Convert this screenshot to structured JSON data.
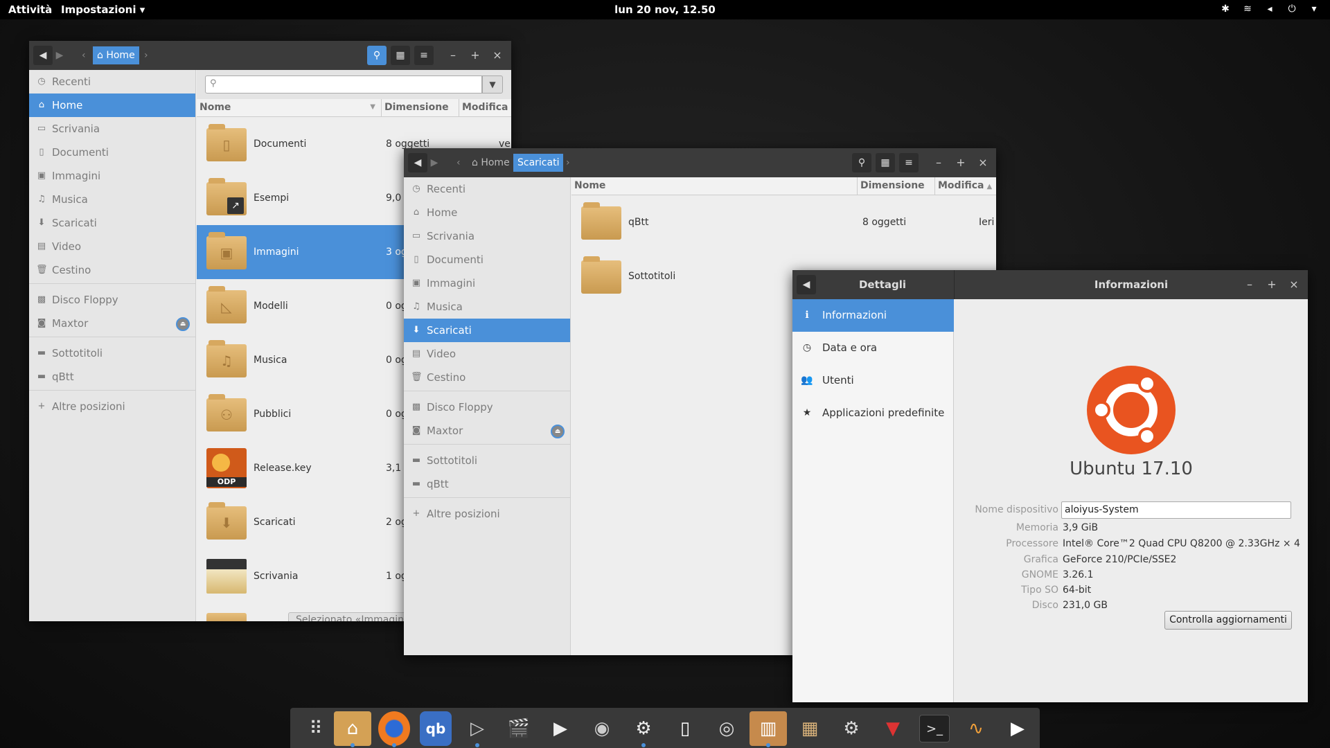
{
  "top_panel": {
    "activities": "Attività",
    "app_menu": "Impostazioni ▾",
    "clock": "lun 20 nov, 12.50"
  },
  "files_home": {
    "path_home": "Home",
    "sidebar": [
      {
        "label": "Recenti",
        "icon": "clock-icon"
      },
      {
        "label": "Home",
        "icon": "home-icon"
      },
      {
        "label": "Scrivania",
        "icon": "desktop-icon"
      },
      {
        "label": "Documenti",
        "icon": "document-icon"
      },
      {
        "label": "Immagini",
        "icon": "image-icon"
      },
      {
        "label": "Musica",
        "icon": "music-icon"
      },
      {
        "label": "Scaricati",
        "icon": "download-icon"
      },
      {
        "label": "Video",
        "icon": "video-icon"
      },
      {
        "label": "Cestino",
        "icon": "trash-icon"
      },
      {
        "label": "Disco Floppy",
        "icon": "floppy-icon"
      },
      {
        "label": "Maxtor",
        "icon": "drive-icon"
      },
      {
        "label": "Sottotitoli",
        "icon": "folder-icon"
      },
      {
        "label": "qBtt",
        "icon": "folder-icon"
      },
      {
        "label": "Altre posizioni",
        "icon": "plus-icon"
      }
    ],
    "columns": {
      "name": "Nome",
      "size": "Dimensione",
      "modified": "Modifica"
    },
    "rows": [
      {
        "name": "Documenti",
        "size": "8 oggetti",
        "modified": "ver"
      },
      {
        "name": "Esempi",
        "size": "9,0"
      },
      {
        "name": "Immagini",
        "size": "3 og"
      },
      {
        "name": "Modelli",
        "size": "0 og"
      },
      {
        "name": "Musica",
        "size": "0 og"
      },
      {
        "name": "Pubblici",
        "size": "0 og"
      },
      {
        "name": "Release.key",
        "size": "3,1",
        "badge": "ODP"
      },
      {
        "name": "Scaricati",
        "size": "2 og"
      },
      {
        "name": "Scrivania",
        "size": "1 og"
      }
    ],
    "status": "Selezionato «Immagini"
  },
  "files_downloads": {
    "path_home": "Home",
    "path_current": "Scaricati",
    "sidebar": [
      "Recenti",
      "Home",
      "Scrivania",
      "Documenti",
      "Immagini",
      "Musica",
      "Scaricati",
      "Video",
      "Cestino",
      "Disco Floppy",
      "Maxtor",
      "Sottotitoli",
      "qBtt",
      "Altre posizioni"
    ],
    "columns": {
      "name": "Nome",
      "size": "Dimensione",
      "modified": "Modifica"
    },
    "rows": [
      {
        "name": "qBtt",
        "size": "8 oggetti",
        "modified": "Ieri"
      },
      {
        "name": "Sottotitoli",
        "size": "",
        "modified": ""
      }
    ]
  },
  "settings": {
    "left_title": "Dettagli",
    "right_title": "Informazioni",
    "menu": [
      "Informazioni",
      "Data e ora",
      "Utenti",
      "Applicazioni predefinite"
    ],
    "os_name": "Ubuntu 17.10",
    "device_label": "Nome dispositivo",
    "device_value": "aloiyus-System",
    "info": [
      {
        "label": "Memoria",
        "value": "3,9 GiB"
      },
      {
        "label": "Processore",
        "value": "Intel® Core™2 Quad CPU Q8200 @ 2.33GHz × 4"
      },
      {
        "label": "Grafica",
        "value": "GeForce 210/PCIe/SSE2"
      },
      {
        "label": "GNOME",
        "value": "3.26.1"
      },
      {
        "label": "Tipo SO",
        "value": "64-bit"
      },
      {
        "label": "Disco",
        "value": "231,0 GB"
      }
    ],
    "update_button": "Controlla aggiornamenti",
    "accent": "#4a90d9",
    "ubuntu_orange": "#e95420"
  },
  "dock": [
    "app-grid-icon",
    "files-icon",
    "firefox-icon",
    "qbittorrent-icon",
    "media-player-icon",
    "video-editor-icon",
    "clapper-icon",
    "speaker-icon",
    "system-tool-icon",
    "blank-document-icon",
    "camera-icon",
    "archive-icon",
    "package-installer-icon",
    "settings-gear-icon",
    "tux-suit-icon",
    "terminal-icon",
    "system-monitor-icon",
    "play-circle-icon"
  ]
}
